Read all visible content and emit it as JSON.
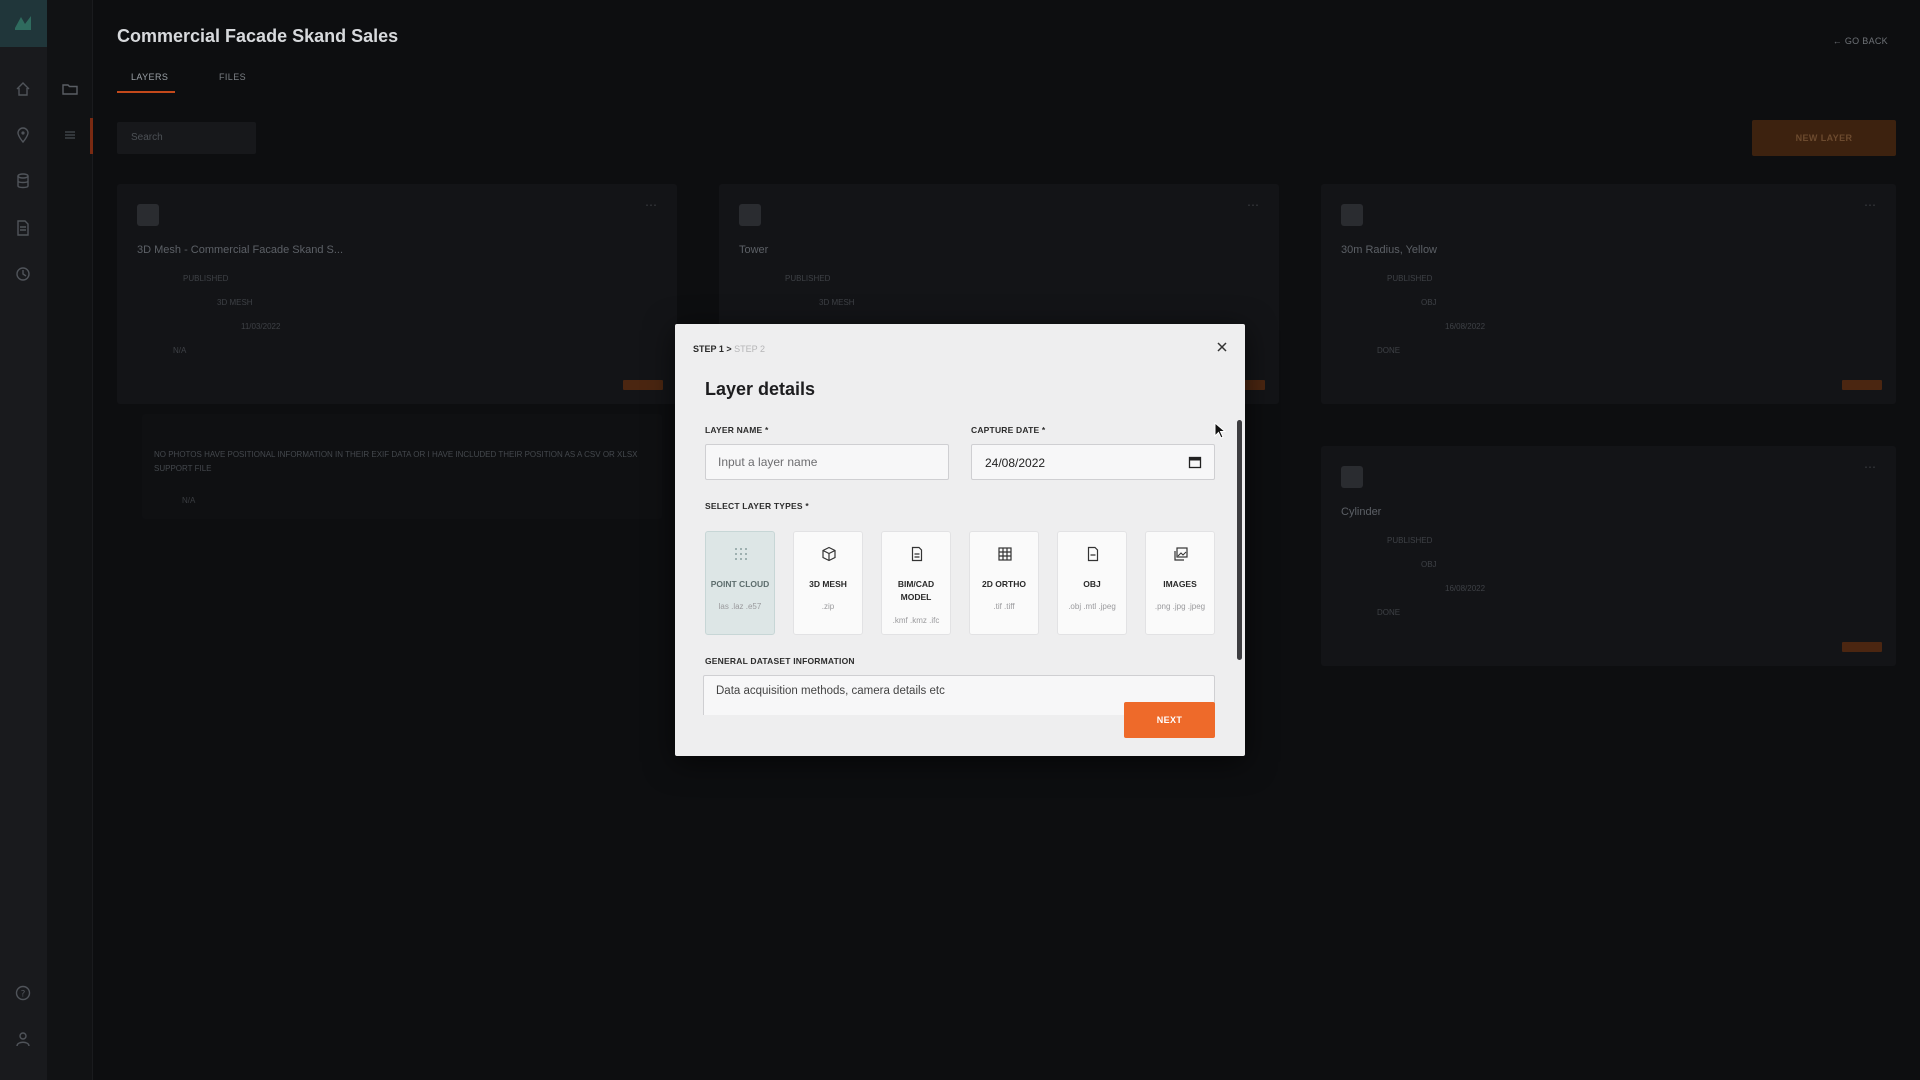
{
  "page": {
    "title": "Commercial Facade Skand Sales",
    "go_back": "GO BACK",
    "tabs": [
      {
        "label": "LAYERS",
        "active": true
      },
      {
        "label": "FILES",
        "active": false
      }
    ],
    "search_placeholder": "Search",
    "new_layer_label": "NEW LAYER"
  },
  "cards": [
    {
      "title": "3D Mesh - Commercial Facade Skand S...",
      "status": "PUBLISHED",
      "type": "3D MESH",
      "date": "11/03/2022",
      "extra": "N/A"
    },
    {
      "title": "Tower",
      "status": "PUBLISHED",
      "type": "3D MESH"
    },
    {
      "title": "30m Radius, Yellow",
      "status": "PUBLISHED",
      "type": "OBJ",
      "date": "16/08/2022",
      "extra": "DONE"
    },
    {
      "title": "Cylinder",
      "status": "PUBLISHED",
      "type": "OBJ",
      "date": "16/08/2022",
      "extra": "DONE"
    }
  ],
  "warning": {
    "body": "NO PHOTOS HAVE POSITIONAL INFORMATION IN THEIR EXIF DATA OR I HAVE INCLUDED THEIR POSITION AS A CSV OR XLSX SUPPORT FILE",
    "footer": "N/A"
  },
  "modal": {
    "step_current": "STEP 1 >",
    "step_next": "STEP 2",
    "title": "Layer details",
    "layer_name_label": "LAYER NAME *",
    "layer_name_placeholder": "Input a layer name",
    "capture_date_label": "CAPTURE DATE *",
    "capture_date_value": "24/08/2022",
    "layer_types_label": "SELECT LAYER TYPES *",
    "layer_types": [
      {
        "name": "POINT CLOUD",
        "ext": "las .laz .e57",
        "icon": "point-cloud-icon",
        "selected": true
      },
      {
        "name": "3D MESH",
        "ext": ".zip",
        "icon": "cube-icon",
        "selected": false
      },
      {
        "name": "BIM/CAD MODEL",
        "ext": ".kmf .kmz .ifc",
        "icon": "document-icon",
        "selected": false
      },
      {
        "name": "2D ORTHO",
        "ext": ".tif .tiff",
        "icon": "grid-icon",
        "selected": false
      },
      {
        "name": "OBJ",
        "ext": ".obj .mtl .jpeg",
        "icon": "file-icon",
        "selected": false
      },
      {
        "name": "IMAGES",
        "ext": ".png .jpg .jpeg",
        "icon": "images-icon",
        "selected": false
      }
    ],
    "dataset_info_label": "GENERAL DATASET INFORMATION",
    "dataset_info_placeholder": "Data acquisition methods, camera details etc",
    "next_label": "NEXT"
  },
  "colors": {
    "accent": "#ee6a2a",
    "modal_bg": "#eeeeef",
    "app_bg": "#0d0e10",
    "selected_tile": "#dde6e6"
  }
}
